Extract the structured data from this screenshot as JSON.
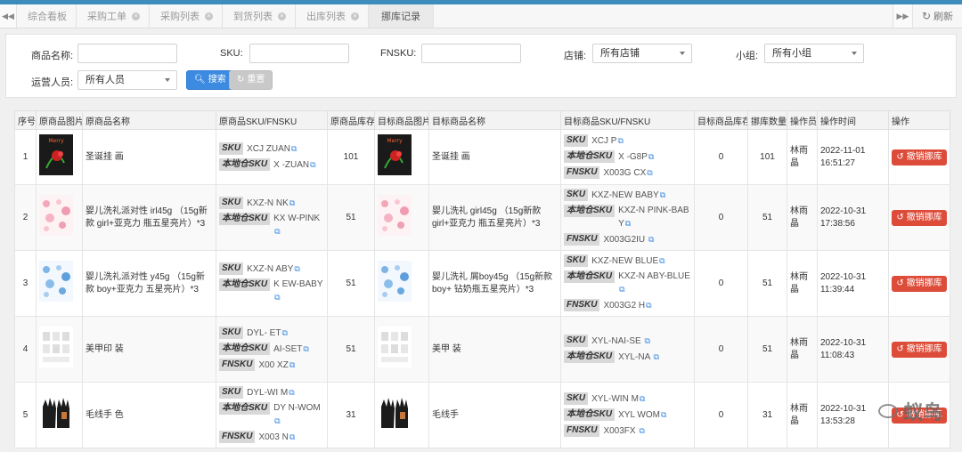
{
  "tabs": [
    {
      "label": "综合看板",
      "closable": false
    },
    {
      "label": "采购工单",
      "closable": true
    },
    {
      "label": "采购列表",
      "closable": true
    },
    {
      "label": "到货列表",
      "closable": true
    },
    {
      "label": "出库列表",
      "closable": true
    },
    {
      "label": "挪库记录",
      "closable": true,
      "active": true
    }
  ],
  "refresh_label": "刷新",
  "filters": {
    "product_name_label": "商品名称:",
    "sku_label": "SKU:",
    "fnsku_label": "FNSKU:",
    "shop_label": "店铺:",
    "shop_value": "所有店铺",
    "group_label": "小组:",
    "group_value": "所有小组",
    "operator_label": "运营人员:",
    "operator_value": "所有人员",
    "search_label": "搜索",
    "reset_label": "重置"
  },
  "table": {
    "headers": [
      "序号",
      "原商品图片",
      "原商品名称",
      "原商品SKU/FNSKU",
      "原商品库存",
      "目标商品图片",
      "目标商品名称",
      "目标商品SKU/FNSKU",
      "目标商品库存",
      "挪库数量",
      "操作员",
      "操作时间",
      "操作"
    ],
    "action_label": "撤销挪库",
    "rows": [
      {
        "index": "1",
        "src_name": "圣诞挂        画",
        "src_sku": [
          [
            "SKU",
            "XCJ         ZUAN"
          ],
          [
            "本地仓SKU",
            "X         -ZUAN"
          ]
        ],
        "src_stock": "101",
        "dst_name": "圣诞挂         画",
        "dst_sku": [
          [
            "SKU",
            "XCJ         P"
          ],
          [
            "本地仓SKU",
            "X        -G8P"
          ],
          [
            "FNSKU",
            "X003G         CX"
          ]
        ],
        "dst_stock": "0",
        "qty": "101",
        "operator": "林雨晶",
        "time": "2022-11-01 16:51:27",
        "img": "flower"
      },
      {
        "index": "2",
        "src_name": "婴儿洗礼派对性     irl45g （15g新款 girl+亚克力     瓶五星亮片）*3",
        "src_sku": [
          [
            "SKU",
            "KXZ-N        NK"
          ],
          [
            "本地仓SKU",
            "KX        W-PINK"
          ]
        ],
        "src_stock": "51",
        "dst_name": "婴儿洗礼       girl45g （15g新款 girl+亚克力       瓶五星亮片）*3",
        "dst_sku": [
          [
            "SKU",
            "KXZ-NEW       BABY"
          ],
          [
            "本地仓SKU",
            "KXZ-N       PINK-BABY"
          ],
          [
            "FNSKU",
            "X003G2IU      "
          ]
        ],
        "dst_stock": "0",
        "qty": "51",
        "operator": "林雨晶",
        "time": "2022-10-31 17:38:56",
        "img": "pink"
      },
      {
        "index": "3",
        "src_name": "婴儿洗礼派对性     y45g （15g新款 boy+亚克力     五星亮片）*3",
        "src_sku": [
          [
            "SKU",
            "KXZ-N        ABY"
          ],
          [
            "本地仓SKU",
            "K        EW-BABY"
          ]
        ],
        "src_stock": "51",
        "dst_name": "婴儿洗礼      屑boy45g （15g新款 boy+      钻奶瓶五星亮片）*3",
        "dst_sku": [
          [
            "SKU",
            "KXZ-NEW       BLUE"
          ],
          [
            "本地仓SKU",
            "KXZ-N       ABY-BLUE"
          ],
          [
            "FNSKU",
            "X003G2       H"
          ]
        ],
        "dst_stock": "0",
        "qty": "51",
        "operator": "林雨晶",
        "time": "2022-10-31 11:39:44",
        "img": "blue"
      },
      {
        "index": "4",
        "src_name": "美甲印      装",
        "src_sku": [
          [
            "SKU",
            "DYL-      ET"
          ],
          [
            "本地仓SKU",
            "       AI-SET"
          ],
          [
            "FNSKU",
            "X00       XZ"
          ]
        ],
        "src_stock": "51",
        "dst_name": "美甲       装",
        "dst_sku": [
          [
            "SKU",
            "XYL-NAI-SE      "
          ],
          [
            "本地仓SKU",
            "XYL-NA       "
          ]
        ],
        "dst_stock": "0",
        "qty": "51",
        "operator": "林雨晶",
        "time": "2022-10-31 11:08:43",
        "img": "nail"
      },
      {
        "index": "5",
        "src_name": "毛线手      色",
        "src_sku": [
          [
            "SKU",
            "DYL-WI       M"
          ],
          [
            "本地仓SKU",
            "DY       N-WOM"
          ],
          [
            "FNSKU",
            "X003       N"
          ]
        ],
        "src_stock": "31",
        "dst_name": "毛线手      ",
        "dst_sku": [
          [
            "SKU",
            "XYL-WIN      M"
          ],
          [
            "本地仓SKU",
            "XYL       WOM"
          ],
          [
            "FNSKU",
            "X003FX       "
          ]
        ],
        "dst_stock": "0",
        "qty": "31",
        "operator": "林雨晶",
        "time": "2022-10-31 13:53:28",
        "img": "glove"
      }
    ]
  },
  "watermark": "蚁鸟",
  "colors": {
    "primary": "#3d8be0",
    "danger": "#dd4b39",
    "topbar": "#3c8dbc"
  }
}
